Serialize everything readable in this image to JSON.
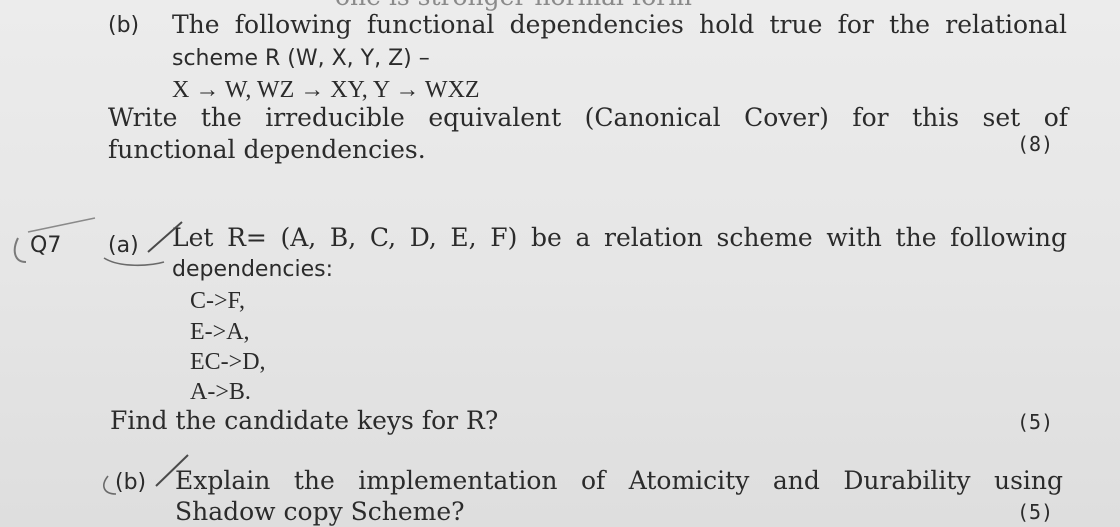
{
  "top_cut_text": "one is stronger normal form",
  "q6b": {
    "label": "(b)",
    "line1": "The following functional dependencies hold true for the relational",
    "line2": "scheme R (W, X, Y, Z) –",
    "line3": "X → W, WZ → XY, Y → WXZ",
    "line4": "Write the irreducible equivalent (Canonical Cover) for this set of",
    "line5": "functional dependencies.",
    "marks": "(8)"
  },
  "q7": {
    "number": "Q7",
    "a": {
      "label": "(a)",
      "line1": "Let R= (A, B, C, D, E, F) be a relation scheme with the following",
      "line2": "dependencies:",
      "dependencies": [
        "C->F,",
        "E->A,",
        "EC->D,",
        "A->B."
      ],
      "question": "Find the candidate keys for R?",
      "marks": "(5)"
    },
    "b": {
      "label": "(b)",
      "line1": "Explain the implementation of Atomicity and Durability using",
      "line2": "Shadow copy Scheme?",
      "marks": "(5)"
    }
  }
}
